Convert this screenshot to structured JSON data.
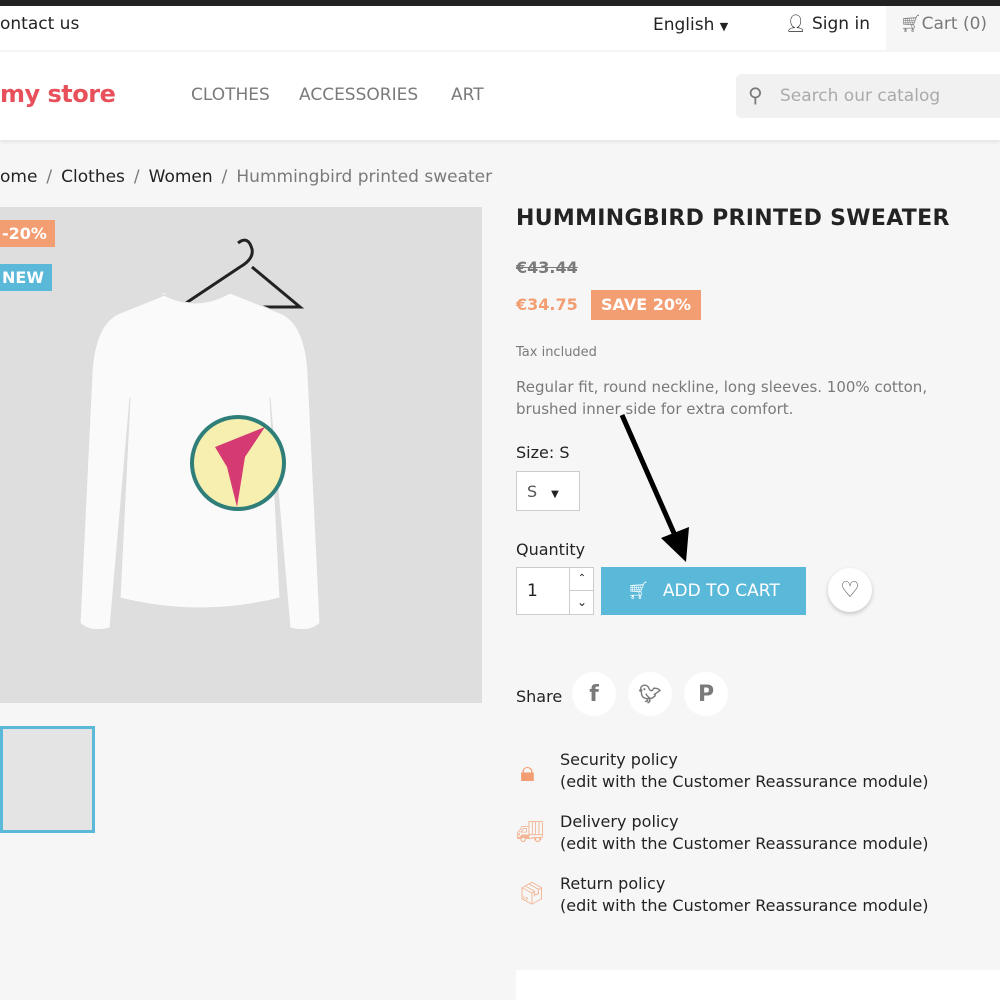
{
  "header": {
    "contact": "ontact us",
    "language": "English",
    "sign_in": "Sign in",
    "cart": "Cart (0)",
    "logo": "my store",
    "menu": [
      "CLOTHES",
      "ACCESSORIES",
      "ART"
    ],
    "search_placeholder": "Search our catalog"
  },
  "breadcrumb": [
    "ome",
    "Clothes",
    "Women",
    "Hummingbird printed sweater"
  ],
  "product": {
    "badges": {
      "discount": "-20%",
      "new": "NEW"
    },
    "title": "HUMMINGBIRD PRINTED SWEATER",
    "old_price": "€43.44",
    "price": "€34.75",
    "save": "SAVE 20%",
    "tax": "Tax included",
    "description": "Regular fit, round neckline, long sleeves. 100% cotton, brushed inner side for extra comfort.",
    "size_label": "Size: S",
    "size_value": "S",
    "quantity_label": "Quantity",
    "quantity": "1",
    "add_to_cart": "ADD TO CART",
    "share_label": "Share"
  },
  "policies": [
    {
      "title": "Security policy",
      "note": "(edit with the Customer Reassurance module)",
      "icon": "lock-icon"
    },
    {
      "title": "Delivery policy",
      "note": "(edit with the Customer Reassurance module)",
      "icon": "truck-icon"
    },
    {
      "title": "Return policy",
      "note": "(edit with the Customer Reassurance module)",
      "icon": "hand-box-icon"
    }
  ],
  "colors": {
    "accent": "#5ab8d9",
    "sale": "#f39d72"
  }
}
